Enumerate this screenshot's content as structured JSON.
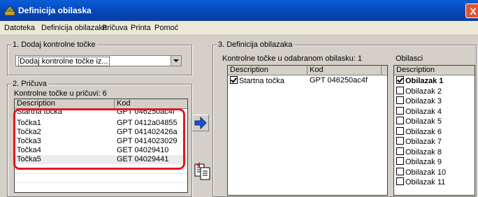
{
  "window": {
    "title": "Definicija obilaska",
    "close": "X"
  },
  "menu": [
    "Datoteka",
    "Definicija obilazaka",
    "Pričuva",
    "Printa",
    "Pomoć"
  ],
  "section1": {
    "label": "1. Dodaj kontrolne točke",
    "combo_value": "Dodaj kontrolne točke iz..."
  },
  "section2": {
    "label": "2. Pričuva",
    "caption": "Kontrolne točke u pričuvi: 6",
    "columns": [
      "Description",
      "Kod"
    ],
    "rows": [
      {
        "desc": "Startna točka",
        "kod": "GPT 046250ac4f"
      },
      {
        "desc": "Točka1",
        "kod": "GPT 0412a04855"
      },
      {
        "desc": "Točka2",
        "kod": "GPT 041402426a"
      },
      {
        "desc": "Točka3",
        "kod": "GPT 0414023029"
      },
      {
        "desc": "Točka4",
        "kod": "GET 04029410"
      },
      {
        "desc": "Točka5",
        "kod": "GET 04029441"
      }
    ]
  },
  "section3": {
    "label": "3. Definicija obilazaka",
    "caption": "Kontrolne točke u odabranom obilasku: 1",
    "columns": [
      "Description",
      "Kod"
    ],
    "rows": [
      {
        "desc": "Startna točka",
        "kod": "GPT 046250ac4f",
        "checked": true
      }
    ]
  },
  "obilasci": {
    "caption": "Obilasci",
    "column": "Description",
    "items": [
      {
        "label": "Obilazak 1",
        "checked": true
      },
      {
        "label": "Obilazak 2",
        "checked": false
      },
      {
        "label": "Obilazak 3",
        "checked": false
      },
      {
        "label": "Obilazak 4",
        "checked": false
      },
      {
        "label": "Obilazak 5",
        "checked": false
      },
      {
        "label": "Obilazak 6",
        "checked": false
      },
      {
        "label": "Obilazak 7",
        "checked": false
      },
      {
        "label": "Obilazak 8",
        "checked": false
      },
      {
        "label": "Obilazak 9",
        "checked": false
      },
      {
        "label": "Obilazak 10",
        "checked": false
      },
      {
        "label": "Obilazak 11",
        "checked": false
      }
    ]
  },
  "colors": {
    "titlebar": "#0646b8",
    "highlight": "#e8141e",
    "arrow": "#1a4fd6"
  },
  "icons": [
    "app-icon",
    "close-icon",
    "chevron-down-icon",
    "arrow-right-icon",
    "paste-icon",
    "checkbox-icon"
  ]
}
